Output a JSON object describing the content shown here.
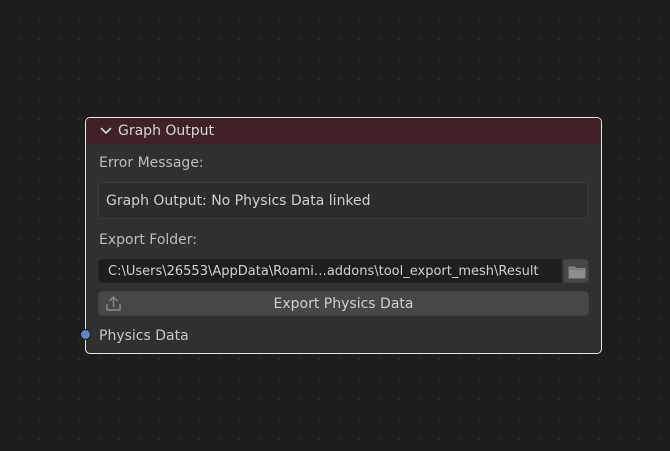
{
  "node": {
    "title": "Graph Output",
    "collapse_icon": "chevron-down-icon",
    "header_color": "#3f2127",
    "border_color": "#e6e6e6",
    "error_label": "Error Message:",
    "error_text": "Graph Output: No Physics Data linked",
    "export_folder_label": "Export Folder:",
    "export_folder_path": "C:\\Users\\26553\\AppData\\Roami…addons\\tool_export_mesh\\Result",
    "folder_icon": "folder-icon",
    "export_button_label": "Export Physics Data",
    "export_icon": "export-icon",
    "socket_label": "Physics Data",
    "socket_color": "#5b86c4"
  }
}
